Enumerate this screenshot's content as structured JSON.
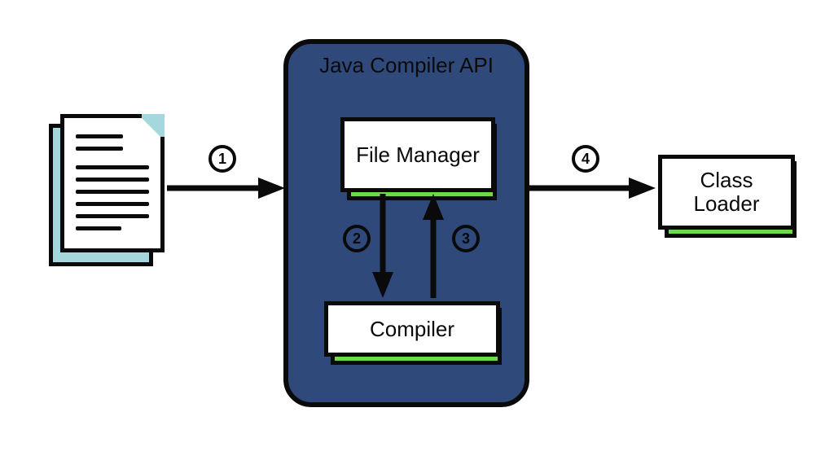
{
  "diagram": {
    "container_title": "Java Compiler API",
    "boxes": {
      "file_manager": "File Manager",
      "compiler": "Compiler",
      "class_loader": "Class Loader"
    },
    "steps": {
      "s1": "1",
      "s2": "2",
      "s3": "3",
      "s4": "4"
    },
    "colors": {
      "container": "#2f4a7a",
      "shadow": "#6fd84c",
      "doc_back": "#a5d8dc",
      "stroke": "#0a0a0a"
    }
  }
}
